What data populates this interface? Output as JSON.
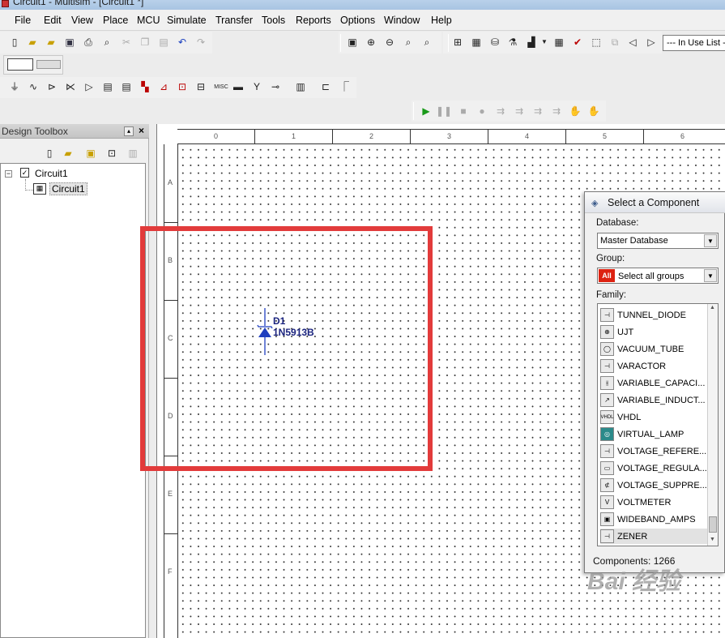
{
  "window_title": "Circuit1 - Multisim - [Circuit1 *]",
  "menu": [
    "File",
    "Edit",
    "View",
    "Place",
    "MCU",
    "Simulate",
    "Transfer",
    "Tools",
    "Reports",
    "Options",
    "Window",
    "Help"
  ],
  "in_use_list": "--- In Use List ---",
  "design_toolbox": {
    "title": "Design Toolbox",
    "tree": {
      "root": "Circuit1",
      "child": "Circuit1"
    }
  },
  "ruler": {
    "columns": [
      "0",
      "1",
      "2",
      "3",
      "4",
      "5",
      "6"
    ],
    "rows": [
      "A",
      "B",
      "C",
      "D",
      "E",
      "F"
    ]
  },
  "component": {
    "ref": "D1",
    "value": "1N5913B"
  },
  "select_component": {
    "title": "Select a Component",
    "database_label": "Database:",
    "database_value": "Master Database",
    "group_label": "Group:",
    "group_badge": "All",
    "group_value": "Select all groups",
    "family_label": "Family:",
    "families": [
      "TUNNEL_DIODE",
      "UJT",
      "VACUUM_TUBE",
      "VARACTOR",
      "VARIABLE_CAPACI...",
      "VARIABLE_INDUCT...",
      "VHDL",
      "VIRTUAL_LAMP",
      "VOLTAGE_REFERE...",
      "VOLTAGE_REGULA...",
      "VOLTAGE_SUPPRE...",
      "VOLTMETER",
      "WIDEBAND_AMPS",
      "ZENER"
    ],
    "selected_family": "ZENER",
    "components_count": "Components: 1266"
  },
  "watermark": "Bai 经验",
  "colors": {
    "highlight": "#e23b3b",
    "diode": "#1f3fbf",
    "label": "#1a237e"
  }
}
